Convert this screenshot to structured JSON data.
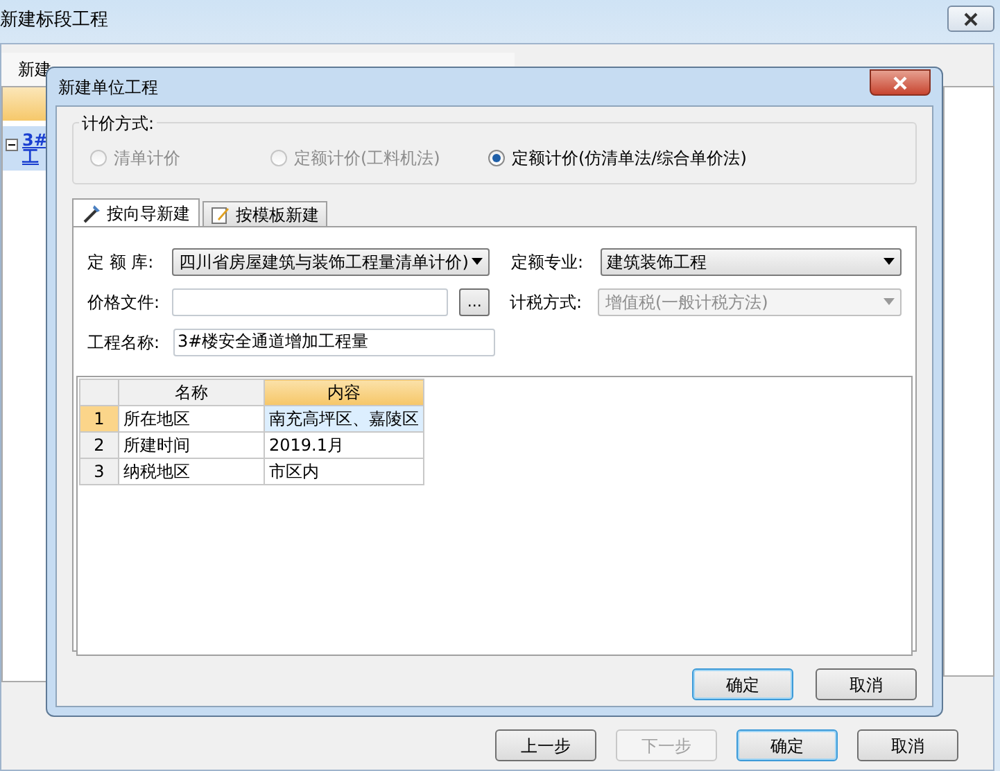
{
  "window": {
    "title": "新建标段工程"
  },
  "toolbar": {
    "items": [
      "新建"
    ]
  },
  "tree": {
    "lines": [
      "3#",
      "工"
    ]
  },
  "dialog": {
    "title": "新建单位工程",
    "pricing": {
      "label": "计价方式:",
      "options": [
        {
          "label": "清单计价",
          "selected": false,
          "disabled": true
        },
        {
          "label": "定额计价(工料机法)",
          "selected": false,
          "disabled": true
        },
        {
          "label": "定额计价(仿清单法/综合单价法)",
          "selected": true,
          "disabled": false
        }
      ]
    },
    "tabs": [
      {
        "label": "按向导新建",
        "selected": true
      },
      {
        "label": "按模板新建",
        "selected": false
      }
    ],
    "form": {
      "quota_library": {
        "label": "定 额 库:",
        "value": "四川省房屋建筑与装饰工程量清单计价)"
      },
      "quota_specialty": {
        "label": "定额专业:",
        "value": "建筑装饰工程"
      },
      "price_file": {
        "label": "价格文件:",
        "button": "..."
      },
      "tax_method": {
        "label": "计税方式:",
        "value": "增值税(一般计税方法)",
        "disabled": true
      },
      "project_name": {
        "label": "工程名称:",
        "value": "3#楼安全通道增加工程量"
      }
    },
    "grid": {
      "columns": [
        {
          "label": "名称",
          "selected": false
        },
        {
          "label": "内容",
          "selected": true
        }
      ],
      "rows": [
        {
          "number": "1",
          "name": "所在地区",
          "content": "南充高坪区、嘉陵区",
          "selected": true
        },
        {
          "number": "2",
          "name": "所建时间",
          "content": "2019.1月",
          "selected": false
        },
        {
          "number": "3",
          "name": "纳税地区",
          "content": "市区内",
          "selected": false
        }
      ]
    },
    "buttons": [
      {
        "label": "确定",
        "default": true
      },
      {
        "label": "取消",
        "default": false
      }
    ]
  },
  "footer_buttons": [
    {
      "label": "上一步",
      "disabled": false,
      "default": false
    },
    {
      "label": "下一步",
      "disabled": true,
      "default": false
    },
    {
      "label": "确定",
      "disabled": false,
      "default": true
    },
    {
      "label": "取消",
      "disabled": false,
      "default": false
    }
  ]
}
